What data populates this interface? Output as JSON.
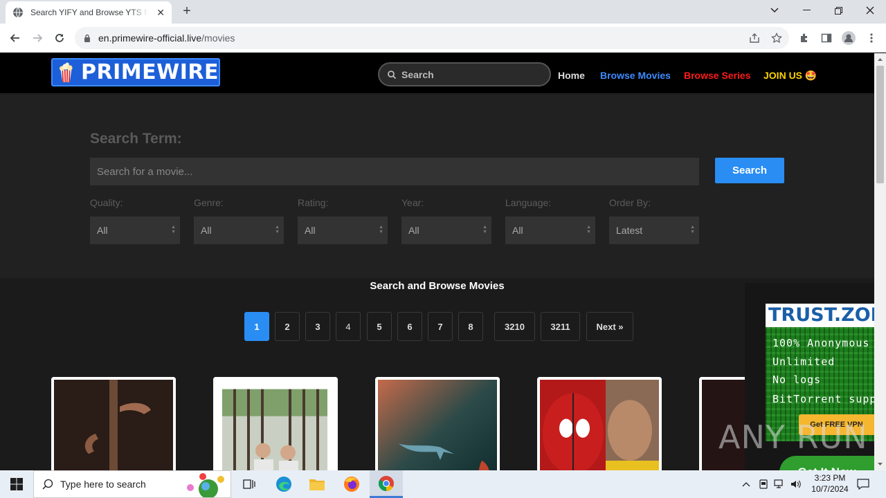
{
  "browser": {
    "tab_title": "Search YIFY and Browse YTS Movies",
    "url_host": "en.primewire-official.live",
    "url_path": "/movies"
  },
  "header": {
    "logo_text_1": "PRIME",
    "logo_text_2": "WIRE",
    "search_placeholder": "Search",
    "nav": {
      "home": "Home",
      "browse_movies": "Browse Movies",
      "browse_series": "Browse Series",
      "join": "JOIN US 🤩"
    },
    "colors": {
      "home": "#dddddd",
      "browse_movies": "#3d8bff",
      "browse_series": "#ff1a1a",
      "join": "#ffd200"
    }
  },
  "filters": {
    "search_term_label": "Search Term:",
    "search_placeholder": "Search for a movie...",
    "search_button": "Search",
    "quality": {
      "label": "Quality:",
      "value": "All"
    },
    "genre": {
      "label": "Genre:",
      "value": "All"
    },
    "rating": {
      "label": "Rating:",
      "value": "All"
    },
    "year": {
      "label": "Year:",
      "value": "All"
    },
    "language": {
      "label": "Language:",
      "value": "All"
    },
    "order_by": {
      "label": "Order By:",
      "value": "Latest"
    }
  },
  "main": {
    "section_title": "Search and Browse Movies",
    "pagination": [
      "1",
      "2",
      "3",
      "4",
      "5",
      "6",
      "7",
      "8",
      "3210",
      "3211",
      "Next »"
    ],
    "active_page": "1",
    "accent": "#2a8df4"
  },
  "ad": {
    "brand": "TRUST.ZONE",
    "lines": [
      "100% Anonymous",
      "Unlimited",
      "No logs",
      "BitTorrent support"
    ],
    "vpn_button": "Get FREE VPN",
    "cta": "Get It Now"
  },
  "watermark": "ANY RUN",
  "taskbar": {
    "search_placeholder": "Type here to search",
    "time": "3:23 PM",
    "date": "10/7/2024"
  }
}
